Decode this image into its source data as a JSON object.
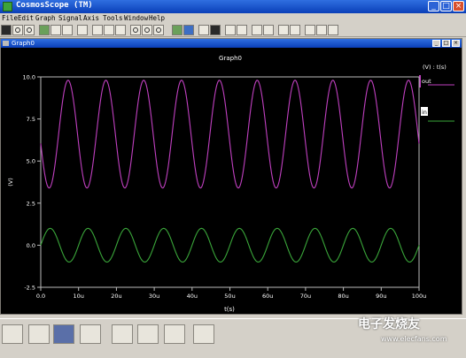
{
  "window": {
    "title": "CosmosScope (TM)"
  },
  "menu": [
    "File",
    "Edit",
    "Graph",
    "Signal",
    "Axis",
    "Tools",
    "Window",
    "Help"
  ],
  "graph_window": {
    "title": "Graph0"
  },
  "chart_data": {
    "type": "line",
    "title": "Graph0",
    "xlabel": "t(s)",
    "ylabel": "(V)",
    "legend_title": "(V) : t(s)",
    "xlim": [
      0,
      100
    ],
    "ylim": [
      -2.5,
      10
    ],
    "x_unit": "u",
    "x_ticks": [
      "0.0",
      "10u",
      "20u",
      "30u",
      "40u",
      "50u",
      "60u",
      "70u",
      "80u",
      "90u",
      "100u"
    ],
    "y_ticks": [
      "10.0",
      "7.5",
      "5.0",
      "2.5",
      "0.0",
      "-2.5"
    ],
    "y_tick_values": [
      10,
      7.5,
      5,
      2.5,
      0,
      -2.5
    ],
    "series": [
      {
        "name": "out",
        "color": "#c040c0",
        "offset": 6.6,
        "amplitude": 3.2,
        "frequency_per_u": 0.1,
        "phase_deg": 190
      },
      {
        "name": "in",
        "color": "#3aa63a",
        "offset": 0.0,
        "amplitude": 1.0,
        "frequency_per_u": 0.1,
        "phase_deg": 0
      }
    ]
  },
  "watermark": {
    "cn": "电子发烧友",
    "url": "www.elecfans.com"
  }
}
